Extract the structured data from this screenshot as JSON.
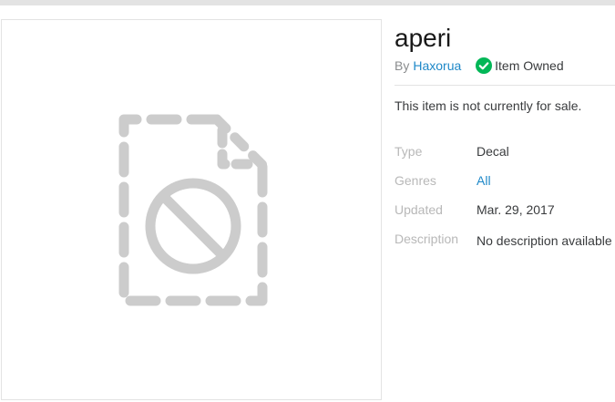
{
  "item": {
    "title": "aperi",
    "by_label": "By",
    "creator": "Haxorua",
    "owned_label": "Item Owned",
    "sale_status": "This item is not currently for sale."
  },
  "details": [
    {
      "label": "Type",
      "value": "Decal",
      "link": false
    },
    {
      "label": "Genres",
      "value": "All",
      "link": true
    },
    {
      "label": "Updated",
      "value": "Mar. 29, 2017",
      "link": false
    },
    {
      "label": "Description",
      "value": "No description available",
      "link": false
    }
  ],
  "icons": {
    "thumbnail_placeholder": "broken-file-icon",
    "owned": "check-circle-icon"
  },
  "colors": {
    "link": "#1e88c8",
    "owned_check": "#02b757",
    "placeholder_gray": "#cccccc"
  }
}
